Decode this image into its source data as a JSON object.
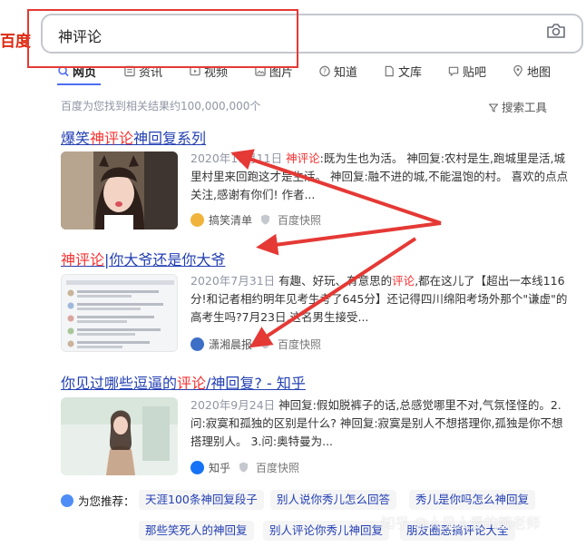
{
  "logo": "百度",
  "search": {
    "query": "神评论"
  },
  "tabs": [
    {
      "label": "网页",
      "icon": "search-icon"
    },
    {
      "label": "资讯",
      "icon": "news-icon"
    },
    {
      "label": "视频",
      "icon": "video-icon"
    },
    {
      "label": "图片",
      "icon": "image-icon"
    },
    {
      "label": "知道",
      "icon": "question-icon"
    },
    {
      "label": "文库",
      "icon": "doc-icon"
    },
    {
      "label": "贴吧",
      "icon": "forum-icon"
    },
    {
      "label": "地图",
      "icon": "map-icon"
    }
  ],
  "result_count": "百度为您找到相关结果约100,000,000个",
  "search_tools": "搜索工具",
  "results": [
    {
      "title_pre": "爆笑",
      "title_em": "神评论",
      "title_post": "神回复系列",
      "date": "2020年11月11日",
      "snippet_em": "神评论",
      "snippet": ":既为生也为活。 神回复:农村是生,跑城里是活,城里村里来回跑这才是生活。 神回复:融不进的城,不能温饱的村。 喜欢的点点关注,感谢有你们! 作者...",
      "source": "搞笑清单",
      "snapshot": "百度快照"
    },
    {
      "title_pre": "",
      "title_em": "神评论",
      "title_post": "|你大爷还是你大爷",
      "date": "2020年7月31日",
      "snippet_pre": "有趣、好玩、有意思的",
      "snippet_em": "评论",
      "snippet": ",都在这儿了【超出一本线116分!和记者相约明年见考生考了645分】还记得四川绵阳考场外那个\"谦虚\"的高考生吗?7月23日,这名男生接受...",
      "source": "潇湘晨报",
      "snapshot": "百度快照"
    },
    {
      "title_pre": "你见过哪些逗逼的",
      "title_em": "评论",
      "title_post": "/神回复? - 知乎",
      "date": "2020年9月24日",
      "snippet": "神回复:假如脱裤子的话,总感觉哪里不对,气氛怪怪的。2.问:寂寞和孤独的区别是什么? 神回复:寂寞是别人不想搭理你,孤独是你不想搭理别人。 3.问:奥特曼为...",
      "source": "知乎",
      "snapshot": "百度快照"
    }
  ],
  "recommend_label": "为您推荐：",
  "recommend": [
    "天涯100条神回复段子",
    "别人说你秀儿怎么回答",
    "秀儿是你吗怎么神回复",
    "那些笑死人的神回复",
    "别人评论你秀儿神回复",
    "朋友圈恶搞评论大全"
  ],
  "watermark": "知乎 @人见人爱的靓老师",
  "colors": {
    "accent": "#4e6ef2",
    "link": "#2440b3",
    "highlight": "#f73131",
    "annotation": "#e53935"
  }
}
